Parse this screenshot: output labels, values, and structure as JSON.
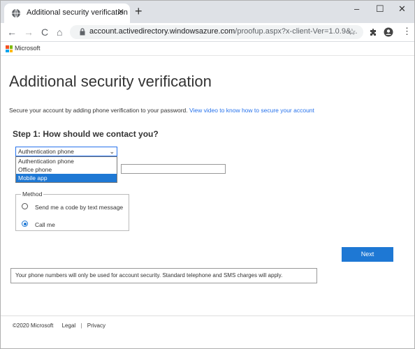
{
  "browser": {
    "tab_title": "Additional security verification",
    "tab_close": "✕",
    "new_tab": "+",
    "window_controls": {
      "minimize": "–",
      "maximize": "☐",
      "close": "✕"
    },
    "nav": {
      "back": "←",
      "forward": "→",
      "reload": "C",
      "home": "⌂"
    },
    "url_host": "account.activedirectory.windowsazure.com",
    "url_path": "/proofup.aspx?x-client-Ver=1.0.9&...",
    "bookmark_star": "☆",
    "extensions_icon": "puzzle-icon",
    "profile_icon": "account-icon",
    "menu": "⋮"
  },
  "brand": {
    "logo_text": "Microsoft",
    "logo_colors": [
      "#f25022",
      "#7fba00",
      "#00a4ef",
      "#ffb900"
    ]
  },
  "page": {
    "title": "Additional security verification",
    "intro_text": "Secure your account by adding phone verification to your password. ",
    "intro_link": "View video to know how to secure your account",
    "step_heading": "Step 1: How should we contact you?",
    "contact_select": {
      "value": "Authentication phone",
      "options": [
        "Authentication phone",
        "Office phone",
        "Mobile app"
      ],
      "highlighted": "Mobile app"
    },
    "method": {
      "legend": "Method",
      "options": [
        {
          "label": "Send me a code by text message",
          "checked": false
        },
        {
          "label": "Call me",
          "checked": true
        }
      ]
    },
    "next_label": "Next",
    "notice": "Your phone numbers will only be used for account security. Standard telephone and SMS charges will apply."
  },
  "footer": {
    "copyright": "©2020 Microsoft",
    "legal": "Legal",
    "separator": "|",
    "privacy": "Privacy"
  },
  "colors": {
    "accent": "#1e78d4",
    "link": "#2672ec"
  }
}
